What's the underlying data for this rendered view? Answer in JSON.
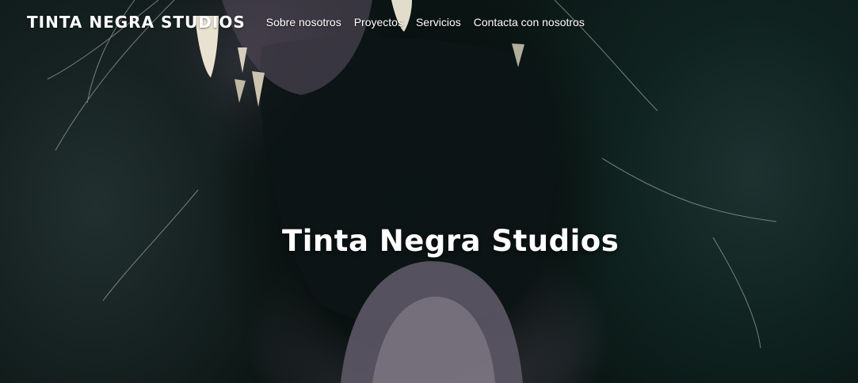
{
  "header": {
    "brand": "TINTA NEGRA STUDIOS",
    "nav": [
      {
        "label": "Sobre nosotros"
      },
      {
        "label": "Proyectos"
      },
      {
        "label": "Servicios"
      },
      {
        "label": "Contacta con nosotros"
      }
    ]
  },
  "hero": {
    "title": "Tinta Negra Studios",
    "background_image": "open-mouth-animal-photo",
    "colors": {
      "text": "#ffffff",
      "background": "#06100e"
    }
  }
}
